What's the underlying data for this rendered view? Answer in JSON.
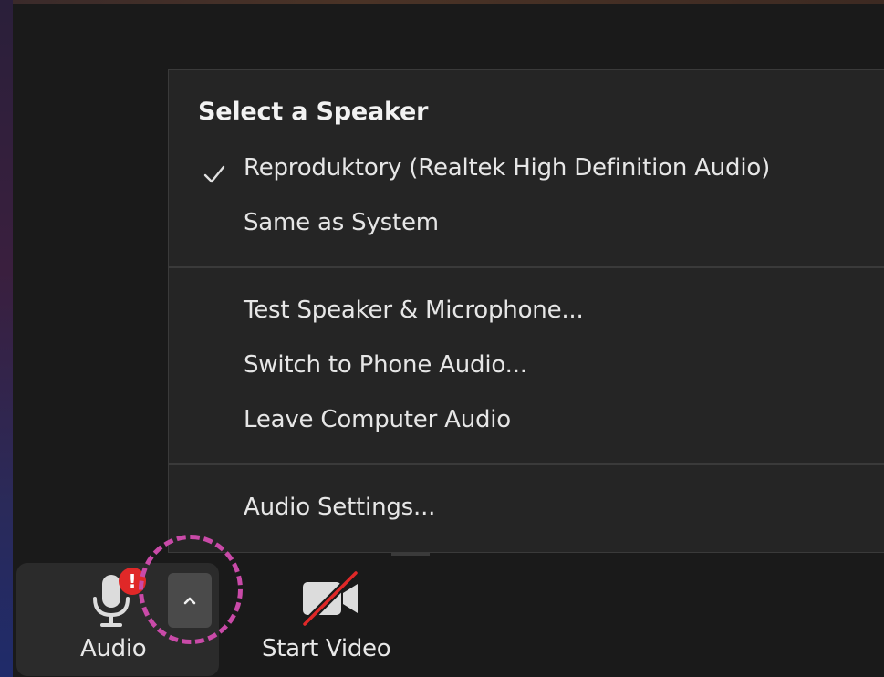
{
  "menu": {
    "heading": "Select a Speaker",
    "speakers": [
      {
        "label": "Reproduktory (Realtek High Definition Audio)",
        "selected": true
      },
      {
        "label": "Same as System",
        "selected": false
      }
    ],
    "actions": [
      {
        "label": "Test Speaker & Microphone..."
      },
      {
        "label": "Switch to Phone Audio..."
      },
      {
        "label": "Leave Computer Audio"
      }
    ],
    "settings_label": "Audio Settings..."
  },
  "toolbar": {
    "audio_label": "Audio",
    "alert_badge": "!",
    "video_label": "Start Video",
    "icons": {
      "audio": "microphone-icon",
      "options": "chevron-up-icon",
      "video": "video-camera-off-icon",
      "selected": "checkmark-icon"
    }
  },
  "colors": {
    "menu_background": "#252525",
    "alert": "#e02828",
    "video_off_slash": "#e02828",
    "highlight_ring": "#c94aa8"
  }
}
